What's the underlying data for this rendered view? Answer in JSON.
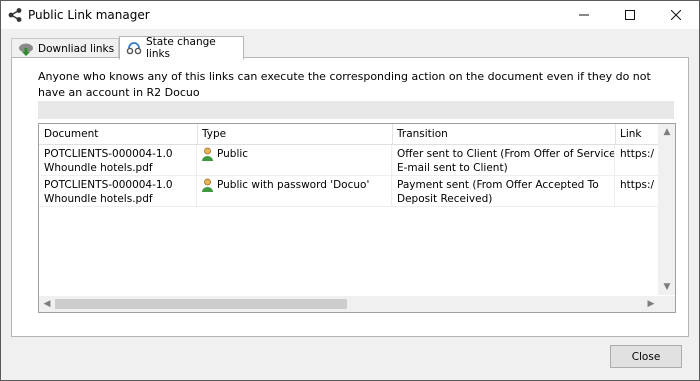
{
  "window": {
    "title": "Public Link manager",
    "icon": "share-icon"
  },
  "tabs": [
    {
      "label": "Downliad links",
      "icon": "cloud-download-icon",
      "active": false
    },
    {
      "label": "State change links",
      "icon": "state-change-icon",
      "active": true
    }
  ],
  "description": "Anyone who knows any of this links can execute the corresponding action on the document even if they do not have an account in R2 Docuo",
  "table": {
    "columns": [
      "Document",
      "Type",
      "Transition",
      "Link"
    ],
    "rows": [
      {
        "document": [
          "POTCLIENTS-000004-1.0",
          "Whoundle hotels.pdf"
        ],
        "type": "Public",
        "type_icon": "user-icon",
        "transition": [
          "Offer sent to Client (From Offer of Service To",
          "E-mail sent to Client)"
        ],
        "link": "https:/"
      },
      {
        "document": [
          "POTCLIENTS-000004-1.0",
          "Whoundle hotels.pdf"
        ],
        "type": "Public with password 'Docuo'",
        "type_icon": "user-icon",
        "transition": [
          "Payment sent (From Offer Accepted To",
          "Deposit Received)"
        ],
        "link": "https:/"
      }
    ]
  },
  "buttons": {
    "close": "Close"
  }
}
